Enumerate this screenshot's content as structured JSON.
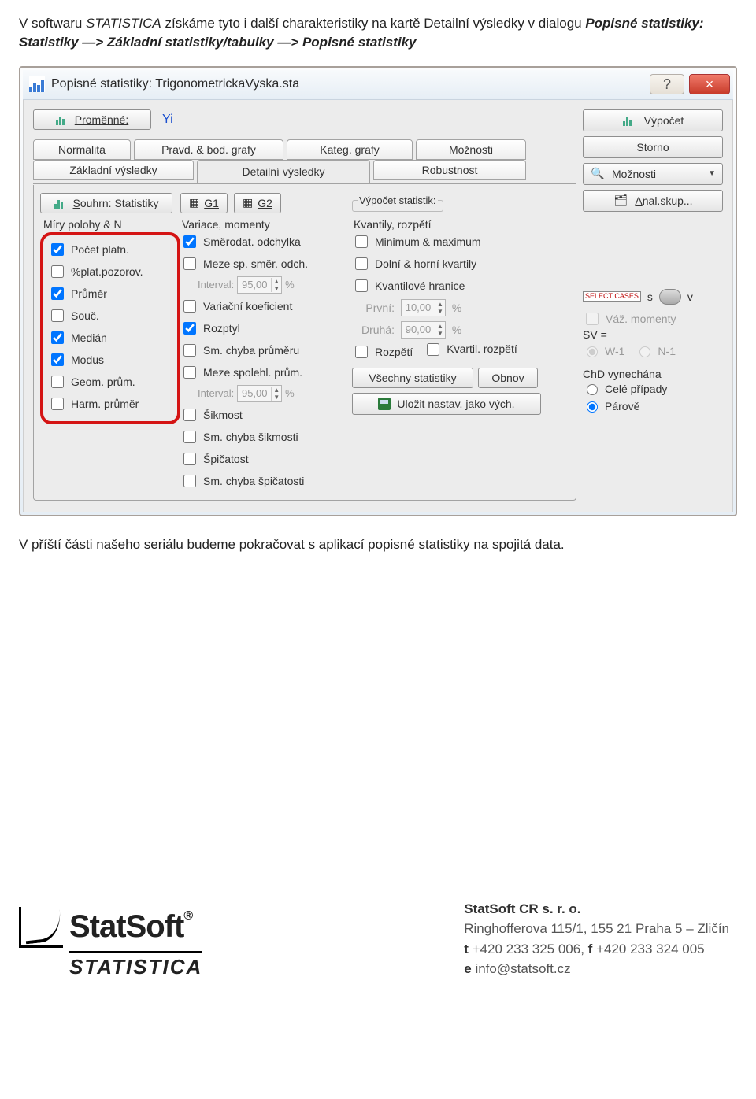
{
  "intro": {
    "part1": "V softwaru ",
    "soft": "STATISTICA",
    "part2": " získáme tyto i další charakteristiky na kartě Detailní výsledky v dialogu ",
    "dlgpath": "Popisné statistiky: Statistiky —> Základní statistiky/tabulky —> Popisné statistiky"
  },
  "dialog": {
    "title": "Popisné statistiky: TrigonometrickaVyska.sta",
    "help_tip": "?",
    "close_tip": "×",
    "promenne_label": "Proměnné:",
    "var_name": "Yi",
    "vypocet": "Výpočet",
    "storno": "Storno",
    "moznosti": "Možnosti",
    "analskup": "Anal.skup...",
    "tabs_back": [
      "Normalita",
      "Pravd. & bod. grafy",
      "Kateg. grafy",
      "Možnosti"
    ],
    "tabs_front": [
      "Základní výsledky",
      "Detailní výsledky",
      "Robustnost"
    ],
    "active_tab": "Detailní výsledky",
    "souhrn_btn": "Souhrn: Statistiky",
    "g1": "G1",
    "g2": "G2",
    "vstat_label": "Výpočet statistik:",
    "col1_header": "Míry polohy & N",
    "col2_header": "Variace, momenty",
    "col3_header": "Kvantily, rozpětí",
    "col1_items": [
      {
        "label": "Počet platn.",
        "checked": true
      },
      {
        "label": "%plat.pozorov.",
        "checked": false
      },
      {
        "label": "Průměr",
        "checked": true
      },
      {
        "label": "Souč.",
        "checked": false
      },
      {
        "label": "Medián",
        "checked": true
      },
      {
        "label": "Modus",
        "checked": true
      },
      {
        "label": "Geom. prům.",
        "checked": false
      },
      {
        "label": "Harm. průměr",
        "checked": false
      }
    ],
    "col2_items_a": [
      {
        "label": "Směrodat. odchylka",
        "checked": true
      },
      {
        "label": "Meze sp. směr. odch.",
        "checked": false
      }
    ],
    "interval1_label": "Interval:",
    "interval1_value": "95,00",
    "col2_items_b": [
      {
        "label": "Variační koeficient",
        "checked": false
      },
      {
        "label": "Rozptyl",
        "checked": true
      },
      {
        "label": "Sm. chyba průměru",
        "checked": false
      },
      {
        "label": "Meze spolehl. prům.",
        "checked": false
      }
    ],
    "interval2_label": "Interval:",
    "interval2_value": "95,00",
    "col2_items_c": [
      {
        "label": "Šikmost",
        "checked": false
      },
      {
        "label": "Sm. chyba šikmosti",
        "checked": false
      },
      {
        "label": "Špičatost",
        "checked": false
      },
      {
        "label": "Sm. chyba špičatosti",
        "checked": false
      }
    ],
    "col3_items_a": [
      {
        "label": "Minimum & maximum",
        "checked": false
      },
      {
        "label": "Dolní & horní kvartily",
        "checked": false
      },
      {
        "label": "Kvantilové hranice",
        "checked": false
      }
    ],
    "prvni_label": "První:",
    "prvni_value": "10,00",
    "druha_label": "Druhá:",
    "druha_value": "90,00",
    "col3_items_b": [
      {
        "label": "Rozpětí",
        "checked": false
      },
      {
        "label": "Kvartil. rozpětí",
        "checked": false
      }
    ],
    "vsechny": "Všechny statistiky",
    "obnov": "Obnov",
    "ulozit": "Uložit nastav. jako vých.",
    "select_cases": "SELECT CASES",
    "s_letter": "s",
    "v_letter": "v",
    "vaz": "Váž. momenty",
    "sv_label": "SV =",
    "sv_w": "W-1",
    "sv_n": "N-1",
    "chd_label": "ChD vynechána",
    "chd_cele": "Celé případy",
    "chd_par": "Párově"
  },
  "outro": "V příští části našeho seriálu budeme pokračovat s aplikací popisné statistiky na spojitá data.",
  "footer": {
    "logo_main": "StatSoft",
    "logo_sub": "STATISTICA",
    "company": "StatSoft CR s. r. o.",
    "address": "Ringhofferova 115/1, 155 21 Praha 5 – Zličín",
    "phone_t": "t",
    "phone": "+420 233 325 006,",
    "phone_f": "f",
    "fax": "+420 233 324 005",
    "email_e": "e",
    "email": "info@statsoft.cz"
  }
}
